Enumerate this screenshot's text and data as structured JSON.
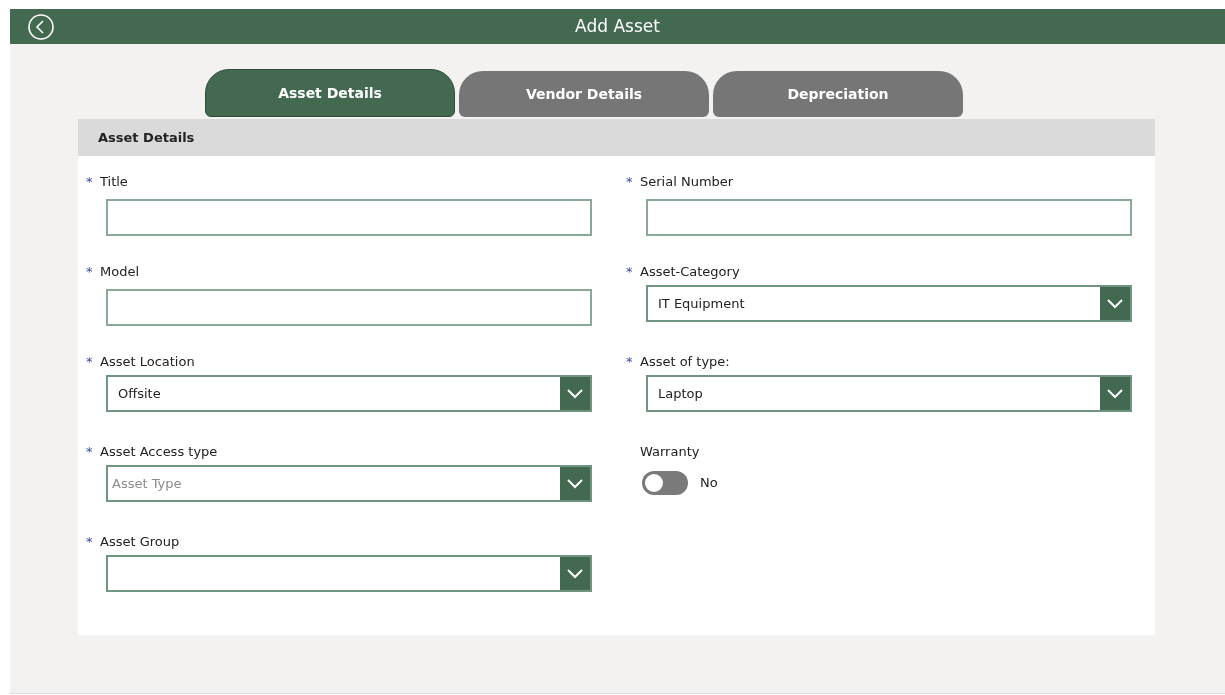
{
  "header": {
    "title": "Add Asset"
  },
  "tabs": [
    {
      "label": "Asset Details",
      "selected": true
    },
    {
      "label": "Vendor Details",
      "selected": false
    },
    {
      "label": "Depreciation",
      "selected": false
    }
  ],
  "section": {
    "title": "Asset Details"
  },
  "columns": [
    [
      {
        "kind": "text",
        "label": "Title",
        "required_mark": "*"
      },
      {
        "kind": "text",
        "label": "Model",
        "required_mark": "*"
      },
      {
        "kind": "dropdown",
        "label": "Asset Location",
        "required_mark": "*",
        "value": "Offsite"
      },
      {
        "kind": "dropdown",
        "label": "Asset Access type",
        "required_mark": "*",
        "placeholder": "Asset Type"
      },
      {
        "kind": "dropdown",
        "label": "Asset Group",
        "required_mark": "*"
      }
    ],
    [
      {
        "kind": "text",
        "label": "Serial Number",
        "required_mark": "*"
      },
      {
        "kind": "dropdown",
        "label": "Asset-Category",
        "required_mark": "*",
        "value": "IT Equipment"
      },
      {
        "kind": "dropdown",
        "label": "Asset of type:",
        "required_mark": "*",
        "value": "Laptop"
      },
      {
        "kind": "toggle",
        "label": "Warranty",
        "on": false,
        "text": "No"
      }
    ]
  ]
}
